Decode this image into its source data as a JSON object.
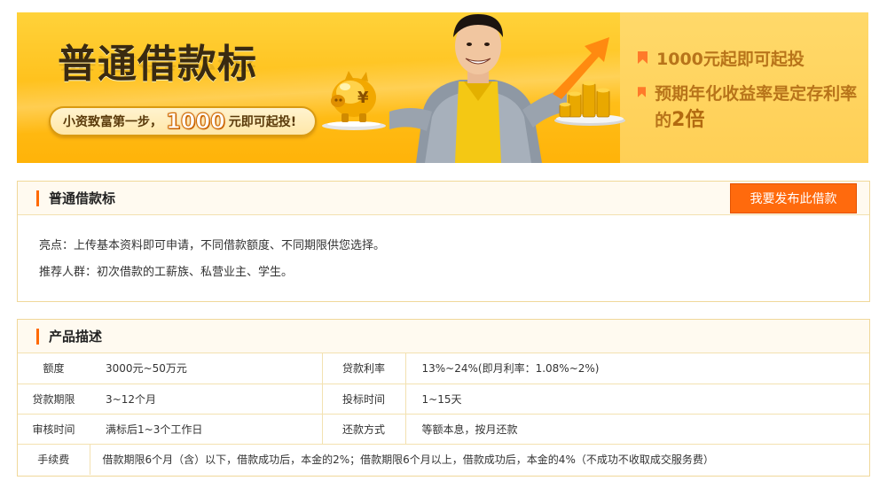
{
  "banner": {
    "title": "普通借款标",
    "slogan_prefix": "小资致富第一步，",
    "slogan_amount": "1000",
    "slogan_suffix": "元即可起投!",
    "perks": [
      {
        "text": "1000元起即可起投"
      },
      {
        "text_before": "预期年化收益率是定存利率的",
        "highlight": "2倍"
      }
    ],
    "colors": {
      "banner_gold": "#ffc21e",
      "perk_text": "#b8741a",
      "flag": "#ff7a2a"
    }
  },
  "summary_panel": {
    "title": "普通借款标",
    "publish_button": "我要发布此借款",
    "highlights": "亮点：上传基本资料即可申请，不同借款额度、不同期限供您选择。",
    "audience": "推荐人群：初次借款的工薪族、私营业主、学生。"
  },
  "product_panel": {
    "title": "产品描述",
    "rows": [
      {
        "k1": "额度",
        "v1": "3000元~50万元",
        "k2": "贷款利率",
        "v2": "13%~24%(即月利率：1.08%~2%)"
      },
      {
        "k1": "贷款期限",
        "v1": "3~12个月",
        "k2": "投标时间",
        "v2": "1~15天"
      },
      {
        "k1": "审核时间",
        "v1": "满标后1~3个工作日",
        "k2": "还款方式",
        "v2": "等额本息，按月还款"
      }
    ],
    "fee_label": "手续费",
    "fee_value": "借款期限6个月（含）以下，借款成功后，本金的2%；借款期限6个月以上，借款成功后，本金的4%（不成功不收取成交服务费）"
  },
  "theme": {
    "accent": "#ff6a00",
    "button": "#ff6a0d",
    "border": "#f0d89a",
    "head_bg": "#fffaf0"
  }
}
